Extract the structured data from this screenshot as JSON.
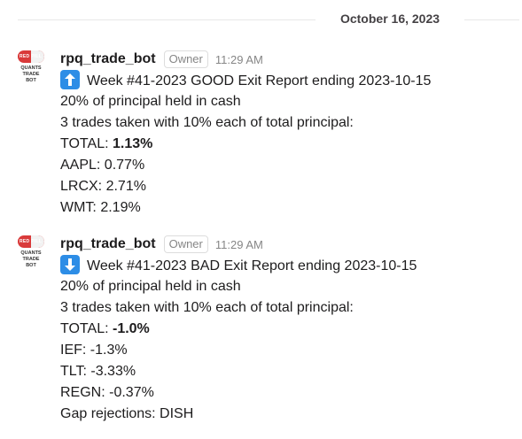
{
  "date_divider": "October 16, 2023",
  "avatar": {
    "pill_text": "RED PILL",
    "line1": "QUANTS",
    "line2": "TRADE",
    "line3": "BOT"
  },
  "messages": [
    {
      "username": "rpq_trade_bot",
      "badge": "Owner",
      "time": "11:29 AM",
      "icon": "arrow-up-icon",
      "title": "Week #41-2023 GOOD Exit Report ending 2023-10-15",
      "cash": "20% of principal held in cash",
      "trades": "3 trades taken with 10% each of total principal:",
      "total_label": "TOTAL: ",
      "total_value": "1.13%",
      "lines": [
        "AAPL: 0.77%",
        "LRCX: 2.71%",
        "WMT: 2.19%"
      ]
    },
    {
      "username": "rpq_trade_bot",
      "badge": "Owner",
      "time": "11:29 AM",
      "icon": "arrow-down-icon",
      "title": "Week #41-2023 BAD Exit Report ending 2023-10-15",
      "cash": "20% of principal held in cash",
      "trades": "3 trades taken with 10% each of total principal:",
      "total_label": "TOTAL: ",
      "total_value": "-1.0%",
      "lines": [
        "IEF: -1.3%",
        "TLT: -3.33%",
        "REGN: -0.37%",
        "Gap rejections: DISH"
      ]
    }
  ],
  "colors": {
    "arrow_icon_bg": "#2d8de6",
    "avatar_red": "#d93a3a"
  }
}
